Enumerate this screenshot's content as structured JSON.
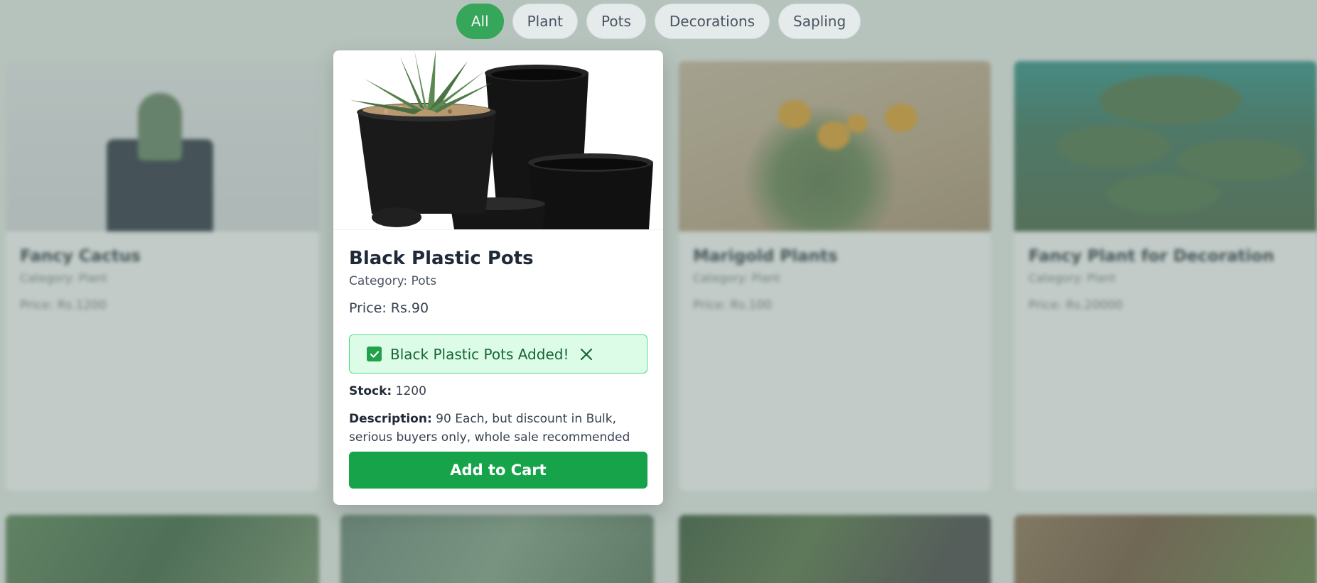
{
  "filters": [
    "All",
    "Plant",
    "Pots",
    "Decorations",
    "Sapling"
  ],
  "products": [
    {
      "title": "Fancy Cactus",
      "category": "Category: Plant",
      "price": "Price: Rs.1200"
    },
    {
      "title": "Marigold Plants",
      "category": "Category: Plant",
      "price": "Price: Rs.100"
    },
    {
      "title": "Fancy Plant for Decoration",
      "category": "Category: Plant",
      "price": "Price: Rs.20000"
    }
  ],
  "modal": {
    "title": "Black Plastic Pots",
    "category": "Category: Pots",
    "price": "Price: Rs.90",
    "toast": "Black Plastic Pots Added!",
    "stock_label": "Stock:",
    "stock_value": "1200",
    "description_label": "Description:",
    "description_value": "90 Each, but discount in Bulk, serious buyers only, whole sale recommended",
    "add_button": "Add to Cart"
  },
  "colors": {
    "accent": "#16a34a",
    "toast_bg": "#dcfce7",
    "toast_border": "#4ade80"
  }
}
